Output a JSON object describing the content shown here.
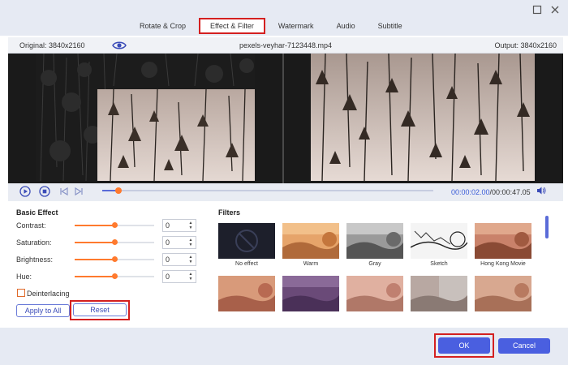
{
  "tabs": [
    {
      "label": "Rotate & Crop"
    },
    {
      "label": "Effect & Filter"
    },
    {
      "label": "Watermark"
    },
    {
      "label": "Audio"
    },
    {
      "label": "Subtitle"
    }
  ],
  "active_tab": "Effect & Filter",
  "info": {
    "original": "Original: 3840x2160",
    "filename": "pexels-veyhar-7123448.mp4",
    "output": "Output: 3840x2160"
  },
  "playback": {
    "current_time": "00:00:02.00",
    "total_time": "/00:00:47.05",
    "progress_fraction": 0.05
  },
  "basic_effect": {
    "title": "Basic Effect",
    "rows": [
      {
        "label": "Contrast:",
        "value": "0",
        "level": 0.5
      },
      {
        "label": "Saturation:",
        "value": "0",
        "level": 0.5
      },
      {
        "label": "Brightness:",
        "value": "0",
        "level": 0.5
      },
      {
        "label": "Hue:",
        "value": "0",
        "level": 0.5
      }
    ],
    "deinterlacing_label": "Deinterlacing",
    "deinterlacing_checked": false,
    "apply_all_label": "Apply to All",
    "reset_label": "Reset"
  },
  "filters": {
    "title": "Filters",
    "row1": [
      {
        "label": "No effect"
      },
      {
        "label": "Warm"
      },
      {
        "label": "Gray"
      },
      {
        "label": "Sketch"
      },
      {
        "label": "Hong Kong Movie"
      }
    ],
    "row2_count": 5
  },
  "footer": {
    "ok_label": "OK",
    "cancel_label": "Cancel"
  },
  "colors": {
    "accent": "#4a5fe0",
    "slider": "#ff7a2e",
    "highlight": "#d42020"
  }
}
